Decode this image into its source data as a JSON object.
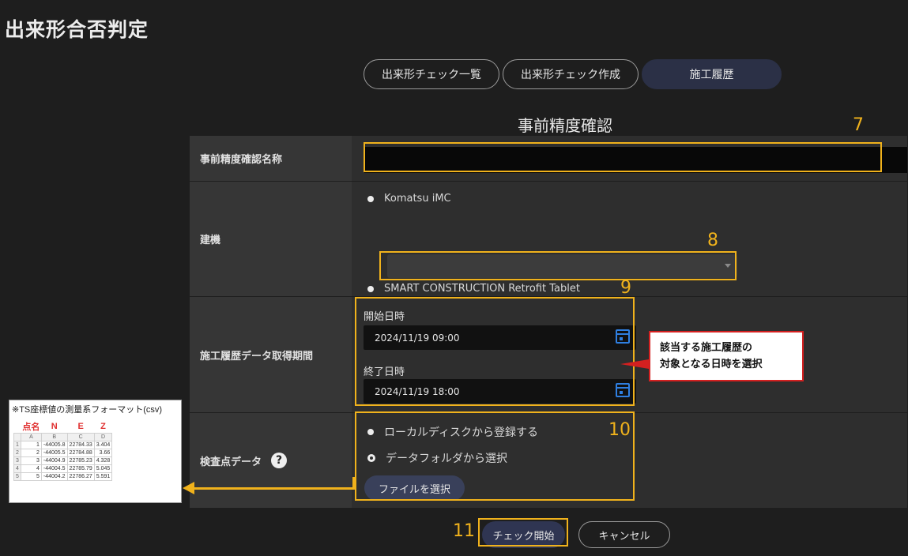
{
  "app": {
    "title": "出来形合否判定"
  },
  "tabs": [
    {
      "label": "出来形チェック一覧"
    },
    {
      "label": "出来形チェック作成"
    },
    {
      "label": "施工履歴"
    }
  ],
  "panel": {
    "title": "事前精度確認"
  },
  "form": {
    "name_label": "事前精度確認名称",
    "name_value": "",
    "machine_label": "建機",
    "machine_options": [
      {
        "label": "Komatsu iMC",
        "selected": false
      },
      {
        "label": "SMART CONSTRUCTION Retrofit Tablet",
        "selected": false
      }
    ],
    "period_label": "施工履歴データ取得期間",
    "start_label": "開始日時",
    "start_value": "2024/11/19 09:00",
    "end_label": "終了日時",
    "end_value": "2024/11/19 18:00",
    "checkpoint_label": "検査点データ",
    "checkpoint_help": "?",
    "checkpoint_options": [
      {
        "label": "ローカルディスクから登録する",
        "selected": false
      },
      {
        "label": "データフォルダから選択",
        "selected": true
      }
    ],
    "file_button": "ファイルを選択"
  },
  "footer": {
    "start_button": "チェック開始",
    "cancel_button": "キャンセル"
  },
  "annotations": {
    "n7": "7",
    "n8": "8",
    "n9": "9",
    "n10": "10",
    "n11": "11",
    "callout_line1": "該当する施工履歴の",
    "callout_line2": "対象となる日時を選択",
    "highlight_color": "#f0b21c",
    "callout_border_color": "#d42020"
  },
  "csv_sample": {
    "caption": "※TS座標値の測量系フォーマット(csv)",
    "headers": [
      "点名",
      "N",
      "E",
      "Z"
    ],
    "columns": [
      "A",
      "B",
      "C",
      "D"
    ],
    "rows": [
      [
        "1",
        "1",
        "-44005.8",
        "22784.33",
        "3.404"
      ],
      [
        "2",
        "2",
        "-44005.5",
        "22784.88",
        "3.66"
      ],
      [
        "3",
        "3",
        "-44004.9",
        "22785.23",
        "4.328"
      ],
      [
        "4",
        "4",
        "-44004.5",
        "22785.79",
        "5.045"
      ],
      [
        "5",
        "5",
        "-44004.2",
        "22786.27",
        "5.591"
      ]
    ]
  },
  "colors": {
    "accent_tab": "#2b3046",
    "button": "#2f3552",
    "calendar_icon": "#2f7fe0"
  }
}
